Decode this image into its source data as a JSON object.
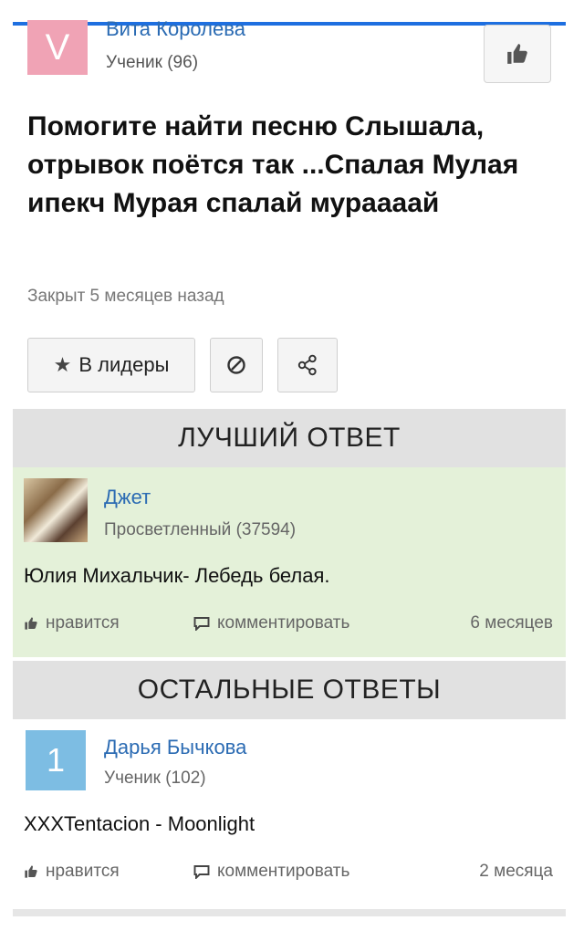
{
  "question": {
    "author": {
      "avatar_letter": "V",
      "name": "Вита Королева",
      "rank": "Ученик (96)"
    },
    "title": "Помогите найти песню Слышала, отрывок поётся так ...Спалая Мулая ипекч Мурая спалай мураааай",
    "status": "Закрыт 5 месяцев назад",
    "actions": {
      "leaders_label": "В лидеры"
    }
  },
  "best_answer": {
    "section_title": "ЛУЧШИЙ ОТВЕТ",
    "author": {
      "name": "Джет",
      "rank": "Просветленный (37594)"
    },
    "text": "Юлия Михальчик- Лебедь белая.",
    "like_label": "нравится",
    "comment_label": "комментировать",
    "time": "6 месяцев"
  },
  "other_answers": {
    "section_title": "ОСТАЛЬНЫЕ ОТВЕТЫ",
    "items": [
      {
        "number": "1",
        "author": {
          "name": "Дарья Бычкова",
          "rank": "Ученик (102)"
        },
        "text": "XXXTentacion - Moonlight",
        "like_label": "нравится",
        "comment_label": "комментировать",
        "time": "2 месяца"
      }
    ]
  },
  "colors": {
    "accent_bar": "#1e6fe0",
    "link": "#2b6bb3",
    "best_answer_bg": "#e4f1d9",
    "section_header_bg": "#e1e1e1",
    "question_avatar_bg": "#f0a3b5",
    "answer_avatar_bg": "#7dbde3"
  }
}
